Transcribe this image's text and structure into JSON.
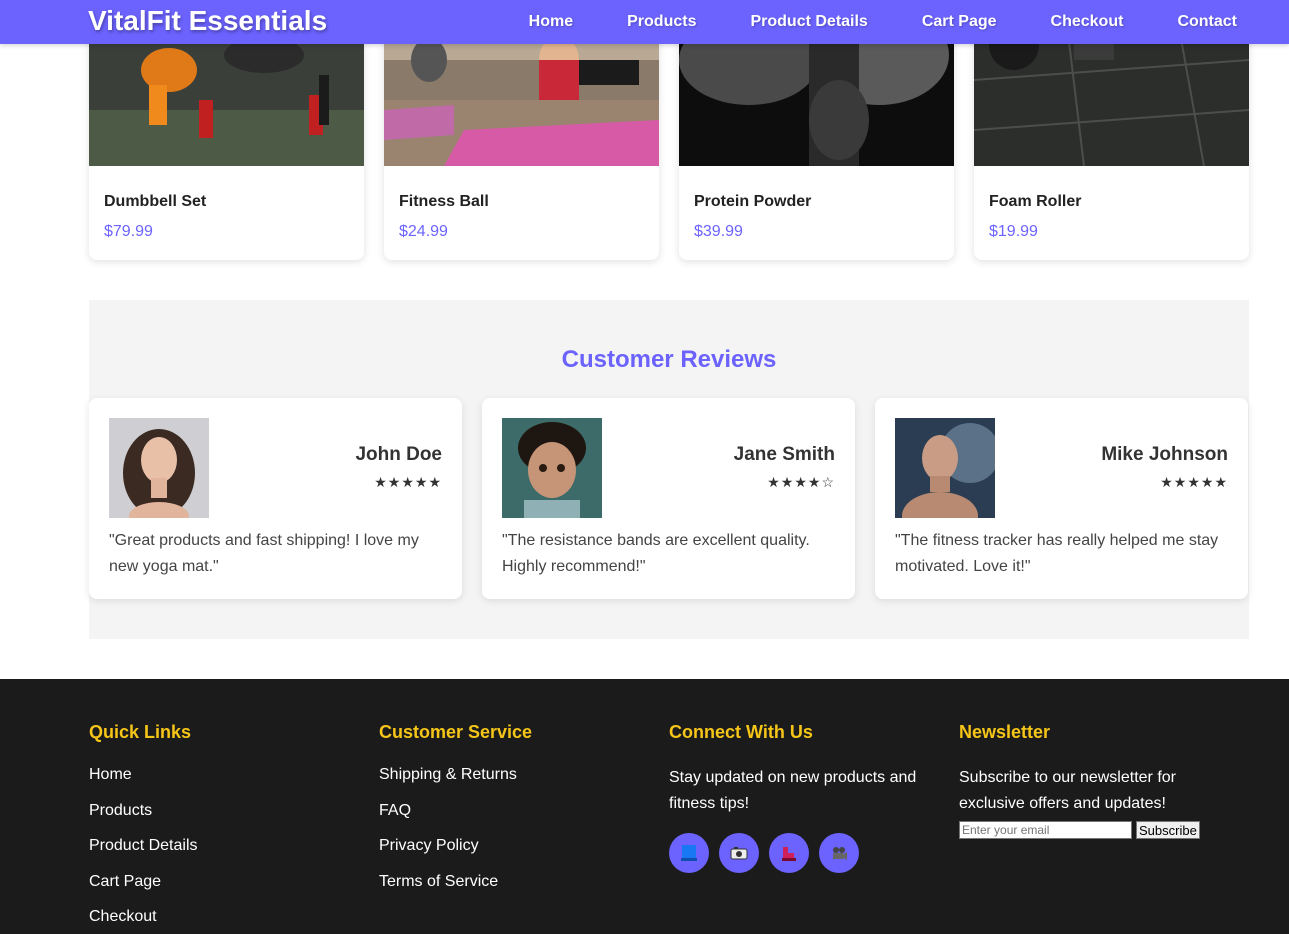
{
  "header": {
    "brand": "VitalFit Essentials",
    "nav": [
      "Home",
      "Products",
      "Product Details",
      "Cart Page",
      "Checkout",
      "Contact"
    ]
  },
  "products": [
    {
      "name": "Dumbbell Set",
      "price": "$79.99"
    },
    {
      "name": "Fitness Ball",
      "price": "$24.99"
    },
    {
      "name": "Protein Powder",
      "price": "$39.99"
    },
    {
      "name": "Foam Roller",
      "price": "$19.99"
    }
  ],
  "reviews": {
    "title": "Customer Reviews",
    "items": [
      {
        "name": "John Doe",
        "stars": "★★★★★",
        "rating": 5,
        "text": "\"Great products and fast shipping! I love my new yoga mat.\""
      },
      {
        "name": "Jane Smith",
        "stars": "★★★★☆",
        "rating": 4,
        "text": "\"The resistance bands are excellent quality. Highly recommend!\""
      },
      {
        "name": "Mike Johnson",
        "stars": "★★★★★",
        "rating": 5,
        "text": "\"The fitness tracker has really helped me stay motivated. Love it!\""
      }
    ]
  },
  "footer": {
    "quick_links": {
      "title": "Quick Links",
      "links": [
        "Home",
        "Products",
        "Product Details",
        "Cart Page",
        "Checkout"
      ]
    },
    "customer_service": {
      "title": "Customer Service",
      "links": [
        "Shipping & Returns",
        "FAQ",
        "Privacy Policy",
        "Terms of Service"
      ]
    },
    "connect": {
      "title": "Connect With Us",
      "text": "Stay updated on new products and fitness tips!",
      "icons": [
        "facebook-icon",
        "instagram-icon",
        "twitter-icon",
        "youtube-icon"
      ]
    },
    "newsletter": {
      "title": "Newsletter",
      "text": "Subscribe to our newsletter for exclusive offers and updates!",
      "placeholder": "Enter your email",
      "button": "Subscribe"
    }
  },
  "colors": {
    "accent": "#6c63ff",
    "footer_bg": "#1b1b1b",
    "footer_heading": "#f5c518",
    "reviews_bg": "#f4f4f4"
  }
}
